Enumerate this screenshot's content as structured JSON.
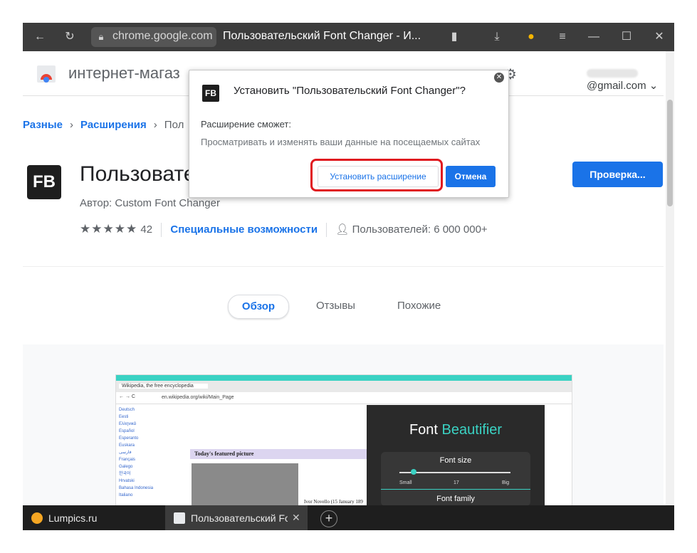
{
  "browser": {
    "url_domain": "chrome.google.com",
    "page_title": "Пользовательский Font Changer - И..."
  },
  "store": {
    "title": "интернет-магаз",
    "account_email": "@gmail.com"
  },
  "breadcrumbs": [
    "Разные",
    "Расширения",
    "Пол"
  ],
  "extension": {
    "logo_text": "FB",
    "name": "Пользовате",
    "author": "Автор: Custom Font Changer",
    "stars": "★★★★★",
    "rating_count": "42",
    "category": "Специальные возможности",
    "users": "Пользователей: 6 000 000+",
    "check_button": "Проверка..."
  },
  "page_tabs": [
    "Обзор",
    "Отзывы",
    "Похожие"
  ],
  "preview": {
    "tab_title": "Wikipedia, the free encyclopedia",
    "address": "en.wikipedia.org/wiki/Main_Page",
    "languages": [
      "Deutsch",
      "Eesti",
      "Ελληνικά",
      "Español",
      "Esperanto",
      "Euskara",
      "فارسی",
      "Français",
      "Galego",
      "한국어",
      "Hrvatski",
      "Bahasa Indonesia",
      "Italiano"
    ],
    "featured_heading": "Today's featured picture",
    "caption": "Ivor Novello (15 January 189",
    "panel_title_1": "Font",
    "panel_title_2": "Beautifier",
    "font_size_label": "Font size",
    "slider_small": "Small",
    "slider_value": "17",
    "slider_big": "Big",
    "font_family_label": "Font family",
    "slider_fraction": 0.13
  },
  "dialog": {
    "title": "Установить \"Пользовательский Font Changer\"?",
    "can_label": "Расширение сможет:",
    "permission": "Просматривать и изменять ваши данные на посещаемых сайтах",
    "install_button": "Установить расширение",
    "cancel_button": "Отмена",
    "logo_text": "FB"
  },
  "taskbar": {
    "items": [
      {
        "label": "Lumpics.ru",
        "icon": "lumpics-icon"
      },
      {
        "label": "Пользовательский Font",
        "icon": "chrome-store-icon"
      }
    ],
    "close_symbol": "✕",
    "new_tab_symbol": "+"
  },
  "colors": {
    "accent": "#1a73e8",
    "highlight": "#e0191f",
    "teal": "#3ad2c3"
  }
}
